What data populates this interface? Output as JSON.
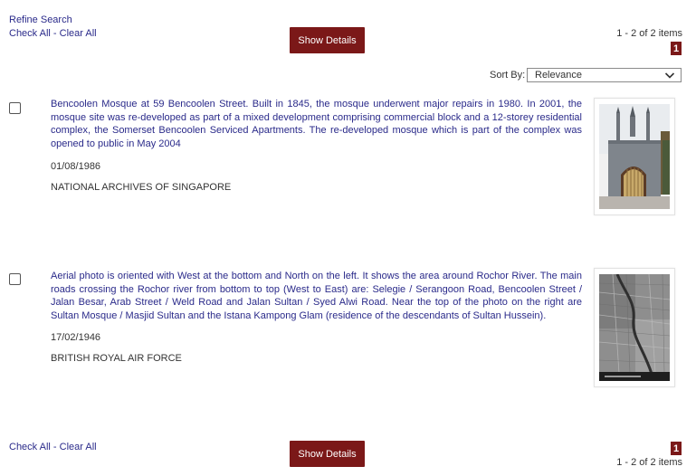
{
  "top": {
    "refine_search": "Refine Search",
    "check_all": "Check All",
    "separator": " - ",
    "clear_all": "Clear All",
    "show_details": "Show Details",
    "items_count": "1 - 2 of 2 items",
    "page": "1"
  },
  "sort": {
    "label": "Sort By:",
    "value": "Relevance",
    "icon": "chevron-down-icon"
  },
  "results": [
    {
      "description": "Bencoolen Mosque at 59 Bencoolen Street. Built in 1845, the mosque underwent major repairs in 1980. In 2001, the mosque site was re-developed as part of a mixed development comprising commercial block and a 12-storey residential complex, the Somerset Bencoolen Serviced Apartments. The re-developed mosque which is part of the complex was opened to public in May 2004",
      "date": "01/08/1986",
      "source": "NATIONAL ARCHIVES OF SINGAPORE",
      "thumbnail": "mosque-photo"
    },
    {
      "description": "Aerial photo is oriented with West at the bottom and North on the left. It shows the area around Rochor River. The main roads crossing the Rochor river from bottom to top (West to East) are: Selegie / Serangoon Road, Bencoolen Street / Jalan Besar, Arab Street / Weld Road and Jalan Sultan / Syed Alwi Road. Near the top of the photo on the right are Sultan Mosque / Masjid Sultan and the Istana Kampong Glam (residence of the descendants of Sultan Hussein).",
      "date": "17/02/1946",
      "source": "BRITISH ROYAL AIR FORCE",
      "thumbnail": "aerial-photo"
    }
  ],
  "bottom": {
    "check_all": "Check All",
    "separator": " - ",
    "clear_all": "Clear All",
    "show_details": "Show Details",
    "page": "1",
    "items_count": "1 - 2 of 2 items"
  },
  "colors": {
    "accent": "#7b1818",
    "link": "#2a2a8a",
    "text": "#333333"
  }
}
